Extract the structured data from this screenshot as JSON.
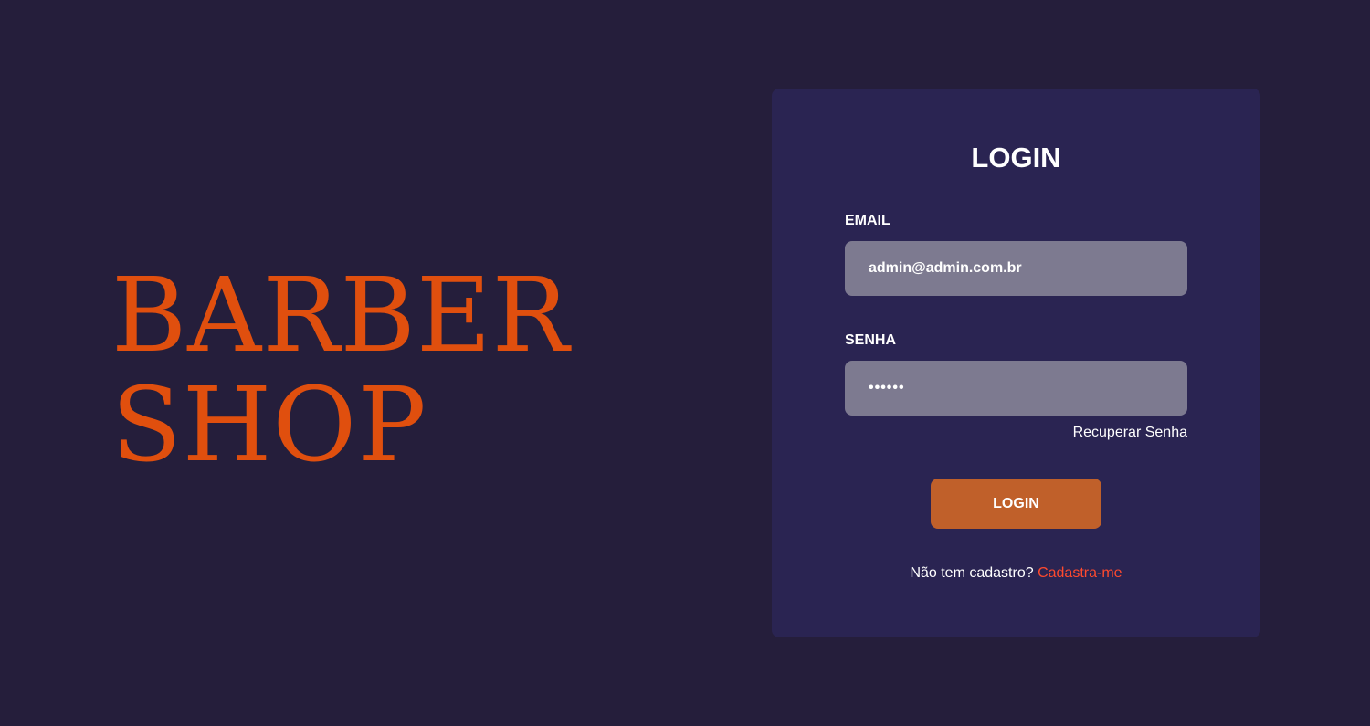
{
  "brand": {
    "line1": "BARBER",
    "line2": "SHOP",
    "color": "#e04f0e"
  },
  "login_card": {
    "title": "LOGIN",
    "email": {
      "label": "EMAIL",
      "value": "admin@admin.com.br"
    },
    "password": {
      "label": "SENHA",
      "value": "••••••"
    },
    "recover_link": "Recuperar Senha",
    "submit_label": "LOGIN",
    "signup_prompt": "Não tem cadastro?",
    "signup_link": "Cadastra-me"
  },
  "colors": {
    "background": "#251e3b",
    "card": "#2a2452",
    "input": "#7d7a90",
    "button": "#c0602a",
    "link_accent": "#ff4a2e"
  }
}
